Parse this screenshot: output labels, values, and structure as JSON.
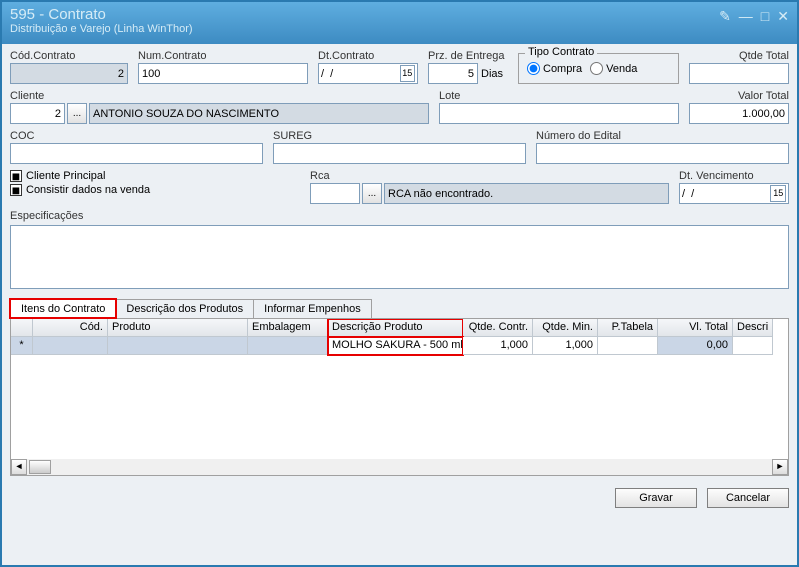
{
  "window": {
    "title": "595 - Contrato",
    "subtitle": "Distribuição e Varejo (Linha WinThor)"
  },
  "labels": {
    "cod_contrato": "Cód.Contrato",
    "num_contrato": "Num.Contrato",
    "dt_contrato": "Dt.Contrato",
    "prz_entrega": "Prz. de Entrega",
    "dias": "Dias",
    "tipo_contrato": "Tipo Contrato",
    "compra": "Compra",
    "venda": "Venda",
    "qtde_total": "Qtde Total",
    "cliente": "Cliente",
    "lote": "Lote",
    "valor_total": "Valor Total",
    "coc": "COC",
    "sureg": "SUREG",
    "num_edital": "Número do Edital",
    "cliente_principal": "Cliente Principal",
    "consistir_dados": "Consistir dados na venda",
    "rca": "Rca",
    "dt_vencimento": "Dt. Vencimento",
    "especificacoes": "Especificações",
    "gravar": "Gravar",
    "cancelar": "Cancelar"
  },
  "fields": {
    "cod_contrato": "2",
    "num_contrato": "100",
    "dt_contrato": "/  /",
    "prz_entrega": "5",
    "cliente_id": "2",
    "cliente_nome": "ANTONIO SOUZA DO NASCIMENTO",
    "valor_total": "1.000,00",
    "rca_msg": "RCA não encontrado.",
    "dt_venc": "/  /"
  },
  "tabs": {
    "itens": "Itens do Contrato",
    "descricao": "Descrição dos Produtos",
    "empenhos": "Informar Empenhos"
  },
  "grid": {
    "headers": {
      "cod": "Cód.",
      "produto": "Produto",
      "embalagem": "Embalagem",
      "descricao": "Descrição Produto",
      "qtde_contr": "Qtde. Contr.",
      "qtde_min": "Qtde. Min.",
      "p_tabela": "P.Tabela",
      "vl_total": "Vl. Total",
      "descri": "Descri"
    },
    "row": {
      "marker": "*",
      "descricao": "MOLHO SAKURA - 500 ml",
      "qtde_contr": "1,000",
      "qtde_min": "1,000",
      "vl_total": "0,00"
    }
  }
}
